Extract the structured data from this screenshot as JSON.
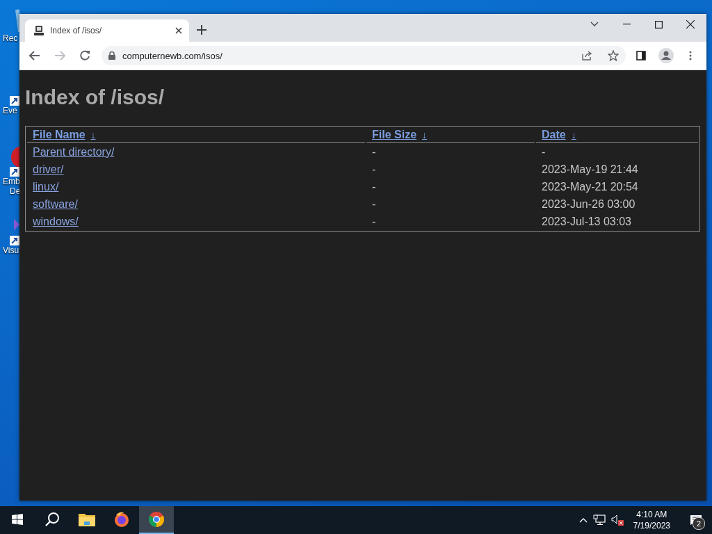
{
  "desktop_icons": [
    {
      "kind": "recycle",
      "lines": [
        "Rec"
      ]
    },
    {
      "kind": "shortcut",
      "lines": [
        "Eve"
      ]
    },
    {
      "kind": "red",
      "lines": [
        "Emb",
        "De"
      ]
    },
    {
      "kind": "purple",
      "lines": [
        "Visu"
      ]
    }
  ],
  "browser": {
    "tabs": [
      {
        "title": "Index of /isos/",
        "selected": true
      }
    ],
    "address": "computernewb.com/isos/",
    "page": {
      "heading": "Index of /isos/",
      "table": {
        "columns": [
          {
            "label": "File Name",
            "sort": "↓"
          },
          {
            "label": "File Size",
            "sort": "↓"
          },
          {
            "label": "Date",
            "sort": "↓"
          }
        ],
        "rows": [
          {
            "name": "Parent directory/",
            "size": "-",
            "date": "-"
          },
          {
            "name": "driver/",
            "size": "-",
            "date": "2023-May-19 21:44"
          },
          {
            "name": "linux/",
            "size": "-",
            "date": "2023-May-21 20:54"
          },
          {
            "name": "software/",
            "size": "-",
            "date": "2023-Jun-26 03:00"
          },
          {
            "name": "windows/",
            "size": "-",
            "date": "2023-Jul-13 03:03"
          }
        ]
      }
    }
  },
  "taskbar": {
    "apps": [
      {
        "kind": "start",
        "active": false
      },
      {
        "kind": "search",
        "active": false
      },
      {
        "kind": "folder",
        "active": false
      },
      {
        "kind": "firefox",
        "active": false
      },
      {
        "kind": "chrome",
        "active": true
      }
    ],
    "time": "4:10 AM",
    "date": "7/19/2023",
    "notifications": "2"
  }
}
